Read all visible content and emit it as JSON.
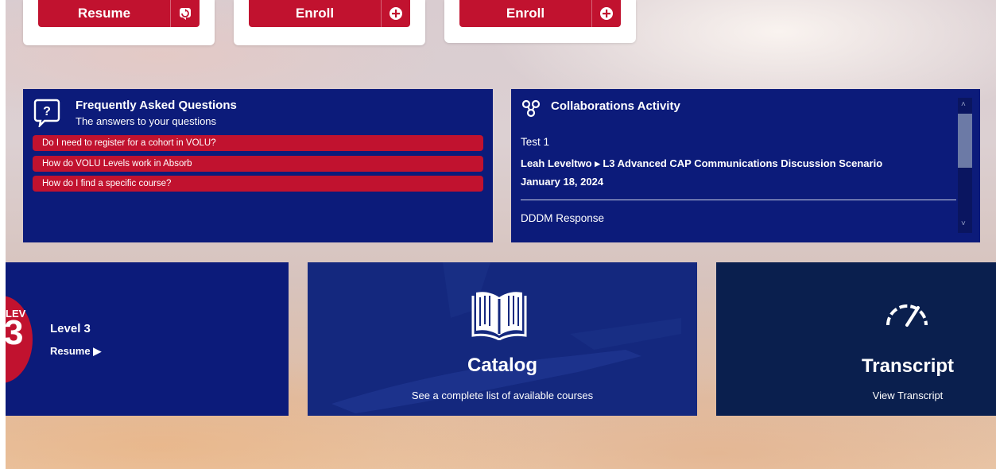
{
  "top_cards": [
    {
      "button_label": "Resume",
      "icon": "resume-icon"
    },
    {
      "button_label": "Enroll",
      "icon": "plus-circle-icon"
    },
    {
      "button_label": "Enroll",
      "icon": "plus-circle-icon"
    }
  ],
  "faq": {
    "title": "Frequently Asked Questions",
    "subtitle": "The answers to your questions",
    "icon": "question-bubble-icon",
    "items": [
      "Do I need to register for a cohort in VOLU?",
      "How do VOLU Levels work in Absorb",
      "How do I find a specific course?"
    ]
  },
  "collab": {
    "title": "Collaborations Activity",
    "icon": "collaboration-icon",
    "entry1_title": "Test 1",
    "entry1_path": "Leah Leveltwo ▸ L3 Advanced CAP Communications Discussion Scenario",
    "entry1_date": "January 18, 2024",
    "entry2_title": "DDDM Response"
  },
  "level": {
    "badge_text": "LEV",
    "badge_number": "3",
    "title": "Level 3",
    "action": "Resume ▶"
  },
  "catalog": {
    "title": "Catalog",
    "subtitle": "See a complete list of available courses",
    "icon": "open-book-icon"
  },
  "transcript": {
    "title": "Transcript",
    "subtitle": "View Transcript",
    "icon": "speedometer-icon"
  },
  "colors": {
    "navy": "#0c1b7a",
    "dark_navy": "#0a1f4e",
    "red": "#c1122f"
  }
}
